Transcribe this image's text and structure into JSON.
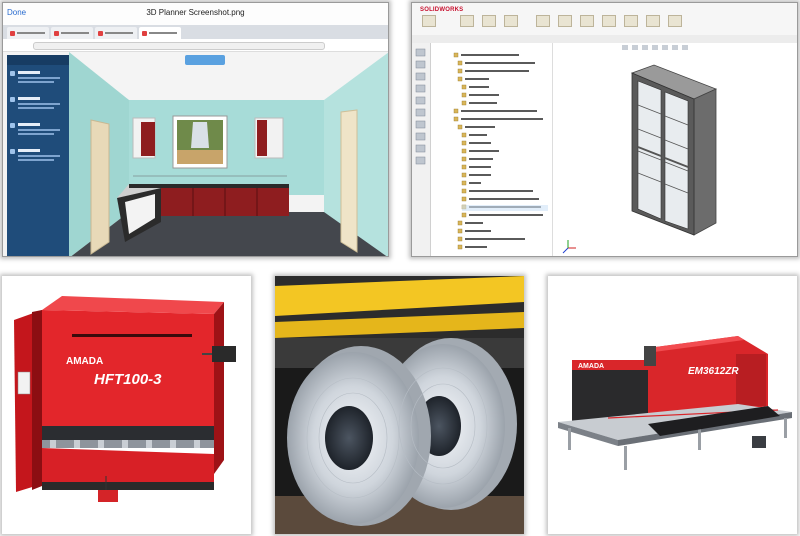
{
  "planner": {
    "window_title": "3D Planner Screenshot.png",
    "done_label": "Done"
  },
  "solidworks": {
    "logo_text": "SOLIDWORKS"
  },
  "press_brake": {
    "brand": "AMADA",
    "model": "HFT100-3"
  },
  "punch_press": {
    "brand": "AMADA",
    "model": "EM3612ZR"
  },
  "colors": {
    "amada_red": "#d9262a",
    "wall_teal": "#a7dcd8",
    "cabinet_red": "#8e1d1f",
    "cabinet_frame": "#5a5a5a"
  }
}
